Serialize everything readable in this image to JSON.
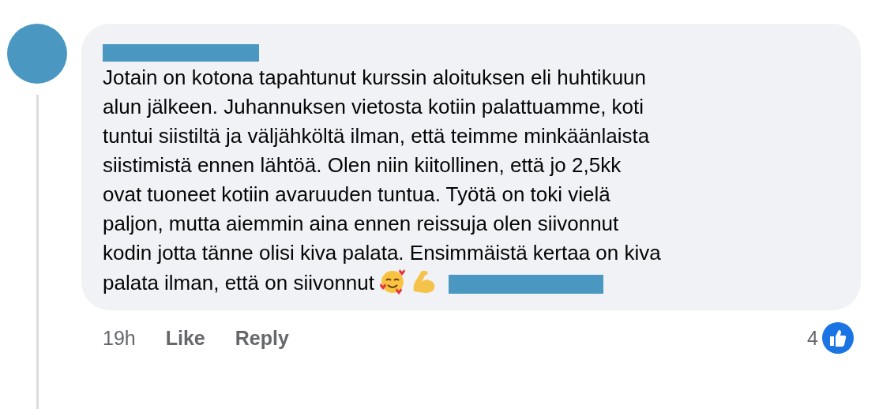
{
  "comment": {
    "author_redacted": true,
    "text": "Jotain on kotona tapahtunut kurssin aloituksen eli huhtikuun\nalun jälkeen. Juhannuksen vietosta kotiin palattuamme, koti\ntuntui siistiltä ja väljähköltä ilman, että teimme minkäänlaista\nsiistimistä ennen lähtöä. Olen niin kiitollinen, että jo 2,5kk\novat tuoneet kotiin avaruuden tuntua. Työtä on toki vielä\npaljon, mutta aiemmin aina ennen reissuja olen siivonnut\nkodin jotta tänne olisi kiva palata. Ensimmäistä kertaa on kiva",
    "text_end": "palata ilman, että on siivonnut",
    "time": "19h",
    "actions": [
      "Like",
      "Reply"
    ],
    "reaction_count": "4"
  }
}
